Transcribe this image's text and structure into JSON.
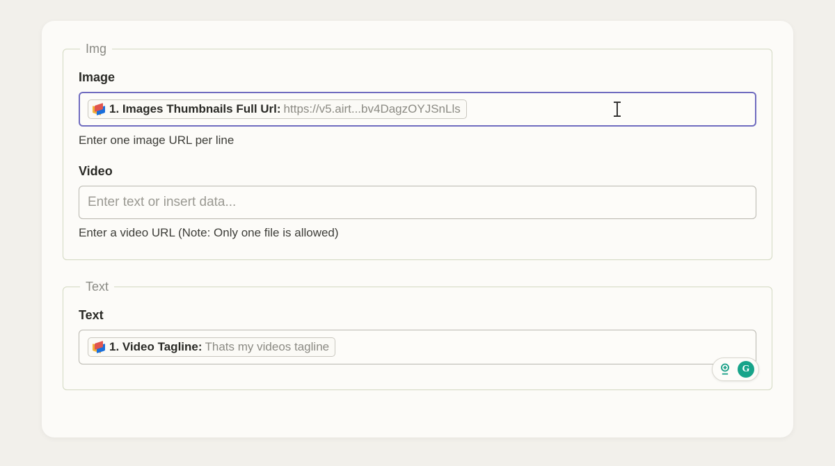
{
  "groups": {
    "img": {
      "legend": "Img",
      "image": {
        "label": "Image",
        "token_label": "1. Images Thumbnails Full Url:",
        "token_value": "https://v5.airt...bv4DagzOYJSnLls",
        "helper": "Enter one image URL per line"
      },
      "video": {
        "label": "Video",
        "placeholder": "Enter text or insert data...",
        "helper": "Enter a video URL (Note: Only one file is allowed)"
      }
    },
    "text": {
      "legend": "Text",
      "text": {
        "label": "Text",
        "token_label": "1. Video Tagline:",
        "token_value": "Thats my videos tagline"
      }
    }
  },
  "controls": {
    "grammarly_letter": "G"
  }
}
